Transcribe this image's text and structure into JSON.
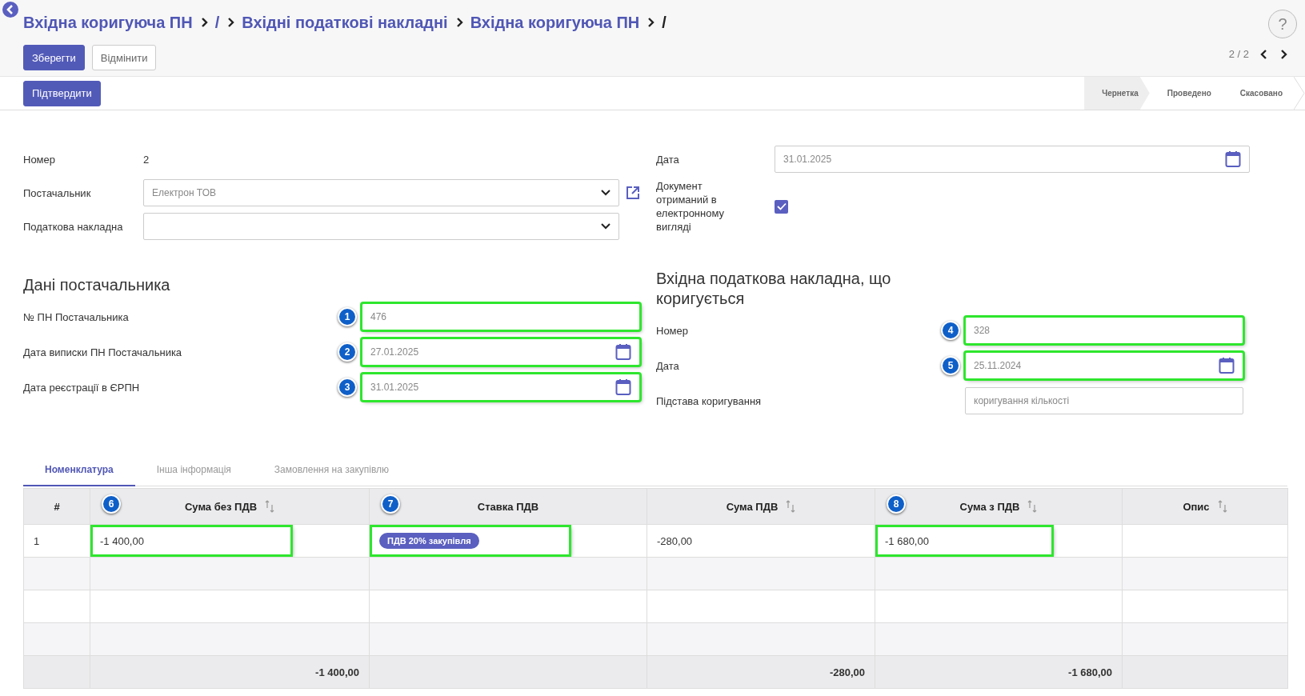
{
  "breadcrumbs": [
    {
      "label": "Вхідна коригуюча ПН",
      "current": false
    },
    {
      "label": "/",
      "current": false
    },
    {
      "label": "Вхідні податкові накладні",
      "current": false
    },
    {
      "label": "Вхідна коригуюча ПН",
      "current": false
    },
    {
      "label": "/",
      "current": true
    }
  ],
  "buttons": [
    {
      "label": "Зберегти",
      "kind": "primary"
    },
    {
      "label": "Відмінити",
      "kind": "secondary"
    }
  ],
  "help": "?",
  "pager": "2 / 2",
  "confirm_button": "Підтвердити",
  "statusbar": [
    {
      "label": "Чернетка",
      "selected": true
    },
    {
      "label": "Проведено",
      "selected": false
    },
    {
      "label": "Скасовано",
      "selected": false
    }
  ],
  "form_left": [
    {
      "label": "Номер",
      "kind": "text",
      "value": "2"
    },
    {
      "label": "Постачальник",
      "kind": "select",
      "value": "Електрон ТОВ",
      "external_link": true
    },
    {
      "label": "Податкова накладна",
      "kind": "select",
      "external_link": false
    }
  ],
  "form_right": [
    {
      "label": "Дата",
      "kind": "date",
      "value": "31.01.2025"
    },
    {
      "label": "Документ отриманий в електронному вигляді",
      "kind": "checkbox",
      "checked": true
    }
  ],
  "supplier_data": {
    "title": "Дані постачальника",
    "fields": [
      {
        "label": "№ ПН Постачальника",
        "kind": "input",
        "value": "476",
        "marker": "1",
        "highlighted": true
      },
      {
        "label": "Дата виписки ПН Постачальника",
        "kind": "date",
        "value": "27.01.2025",
        "marker": "2",
        "highlighted": true
      },
      {
        "label": "Дата реєстрації в ЄРПН",
        "kind": "date",
        "value": "31.01.2025",
        "marker": "3",
        "highlighted": true
      }
    ]
  },
  "corrected_invoice": {
    "title": "Вхідна податкова накладна, що коригується",
    "fields": [
      {
        "label": "Номер",
        "kind": "input",
        "value": "328",
        "marker": "4",
        "highlighted": true
      },
      {
        "label": "Дата",
        "kind": "date",
        "value": "25.11.2024",
        "marker": "5",
        "highlighted": true
      },
      {
        "label": "Підстава коригування",
        "kind": "input",
        "value": "коригування кількості",
        "highlighted": false
      }
    ]
  },
  "tabs": [
    {
      "label": "Номенклатура",
      "selected": true
    },
    {
      "label": "Інша інформація",
      "selected": false
    },
    {
      "label": "Замовлення на закупівлю",
      "selected": false
    }
  ],
  "table": {
    "columns": [
      {
        "label": "#",
        "sortable": false
      },
      {
        "label": "Сума без ПДВ",
        "sortable": true,
        "marker": "6"
      },
      {
        "label": "Ставка ПДВ",
        "sortable": false,
        "marker": "7"
      },
      {
        "label": "Сума ПДВ",
        "sortable": true
      },
      {
        "label": "Сума з ПДВ",
        "sortable": true,
        "marker": "8"
      },
      {
        "label": "Опис",
        "sortable": true
      }
    ],
    "rows": [
      {
        "cells": [
          {
            "kind": "text",
            "text": "1",
            "highlighted": false
          },
          {
            "kind": "text",
            "text": "-1 400,00",
            "highlighted": true
          },
          {
            "kind": "tag",
            "text": "ПДВ 20% закупівля",
            "highlighted": true
          },
          {
            "kind": "text",
            "text": "-280,00",
            "highlighted": false
          },
          {
            "kind": "text",
            "text": "-1 680,00",
            "highlighted": true
          },
          {
            "kind": "blank",
            "highlighted": false
          }
        ]
      }
    ],
    "totals": [
      {
        "kind": "blank"
      },
      {
        "kind": "text",
        "text": "-1 400,00"
      },
      {
        "kind": "blank"
      },
      {
        "kind": "text",
        "text": "-280,00"
      },
      {
        "kind": "text",
        "text": "-1 680,00"
      },
      {
        "kind": "blank"
      }
    ]
  }
}
